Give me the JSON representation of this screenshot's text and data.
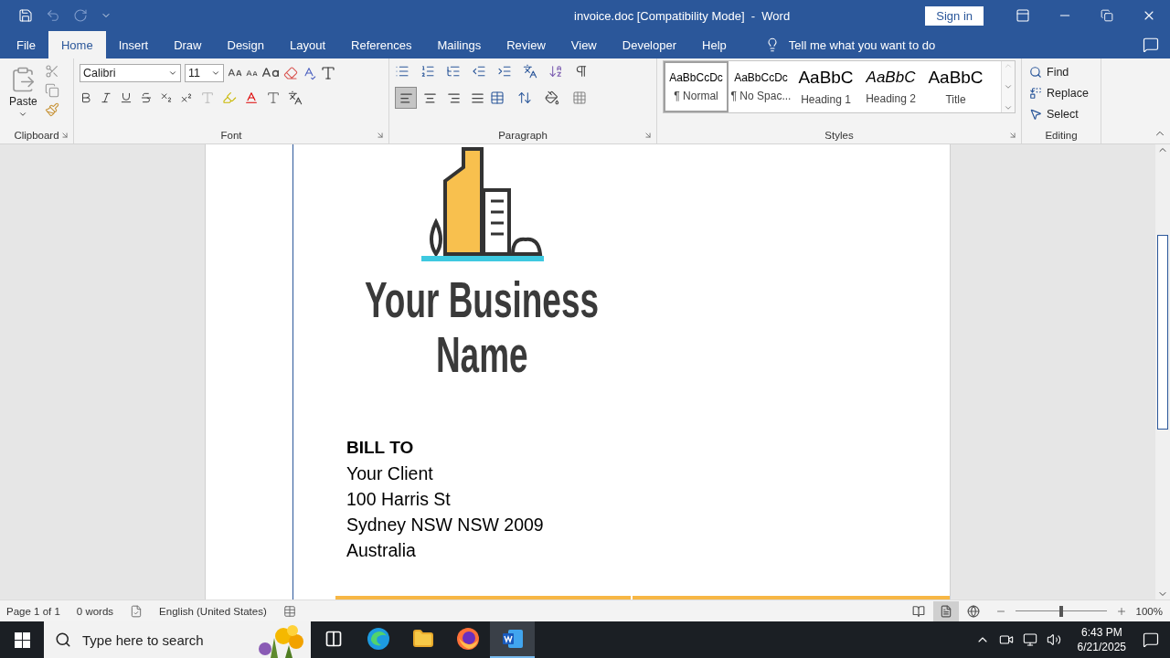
{
  "window": {
    "title": "invoice.doc [Compatibility Mode]  -  Word",
    "sign_in": "Sign in"
  },
  "tabs": [
    {
      "label": "File",
      "selected": false
    },
    {
      "label": "Home",
      "selected": true
    },
    {
      "label": "Insert",
      "selected": false
    },
    {
      "label": "Draw",
      "selected": false
    },
    {
      "label": "Design",
      "selected": false
    },
    {
      "label": "Layout",
      "selected": false
    },
    {
      "label": "References",
      "selected": false
    },
    {
      "label": "Mailings",
      "selected": false
    },
    {
      "label": "Review",
      "selected": false
    },
    {
      "label": "View",
      "selected": false
    },
    {
      "label": "Developer",
      "selected": false
    },
    {
      "label": "Help",
      "selected": false
    }
  ],
  "tell_me": "Tell me what you want to do",
  "ribbon": {
    "clipboard": {
      "paste": "Paste",
      "label": "Clipboard"
    },
    "font": {
      "name": "Calibri",
      "size": "11",
      "label": "Font"
    },
    "paragraph": {
      "label": "Paragraph",
      "alignment": [
        {
          "kind": "left",
          "selected": true
        },
        {
          "kind": "center",
          "selected": false
        },
        {
          "kind": "right",
          "selected": false
        },
        {
          "kind": "justify",
          "selected": false
        }
      ]
    },
    "styles": {
      "label": "Styles",
      "items": [
        {
          "kind": "normal",
          "preview": "AaBbCcDc",
          "name": "¶ Normal",
          "selected": true
        },
        {
          "kind": "nospacing",
          "preview": "AaBbCcDc",
          "name": "¶ No Spac...",
          "selected": false
        },
        {
          "kind": "heading1",
          "preview": "AaBbC",
          "name": "Heading 1",
          "selected": false
        },
        {
          "kind": "heading2",
          "preview": "AaBbC",
          "name": "Heading 2",
          "selected": false
        },
        {
          "kind": "title",
          "preview": "AaBbC",
          "name": "Title",
          "selected": false
        }
      ]
    },
    "editing": {
      "label": "Editing",
      "items": [
        {
          "kind": "find",
          "label": "Find"
        },
        {
          "kind": "replace",
          "label": "Replace"
        },
        {
          "kind": "select",
          "label": "Select"
        }
      ]
    }
  },
  "document": {
    "logo": {
      "lines": [
        "Your Business",
        "Name"
      ]
    },
    "bill_to": {
      "heading": "BILL TO",
      "lines": [
        "Your Client",
        "100 Harris St",
        "Sydney NSW NSW 2009",
        "Australia"
      ]
    }
  },
  "status_bar": {
    "page": "Page 1 of 1",
    "words": "0 words",
    "language": "English (United States)",
    "views": [
      {
        "kind": "read",
        "selected": false
      },
      {
        "kind": "print",
        "selected": true
      },
      {
        "kind": "web",
        "selected": false
      }
    ],
    "zoom": {
      "level": 0.5,
      "reading": "100%"
    }
  },
  "taskbar": {
    "search_placeholder": "Type here to search",
    "apps": [
      {
        "kind": "taskview",
        "selected": false
      },
      {
        "kind": "edge",
        "selected": false
      },
      {
        "kind": "explorer",
        "selected": false
      },
      {
        "kind": "firefox",
        "selected": false
      },
      {
        "kind": "word",
        "selected": true
      }
    ],
    "time": "6:43 PM",
    "date": "6/21/2025"
  }
}
